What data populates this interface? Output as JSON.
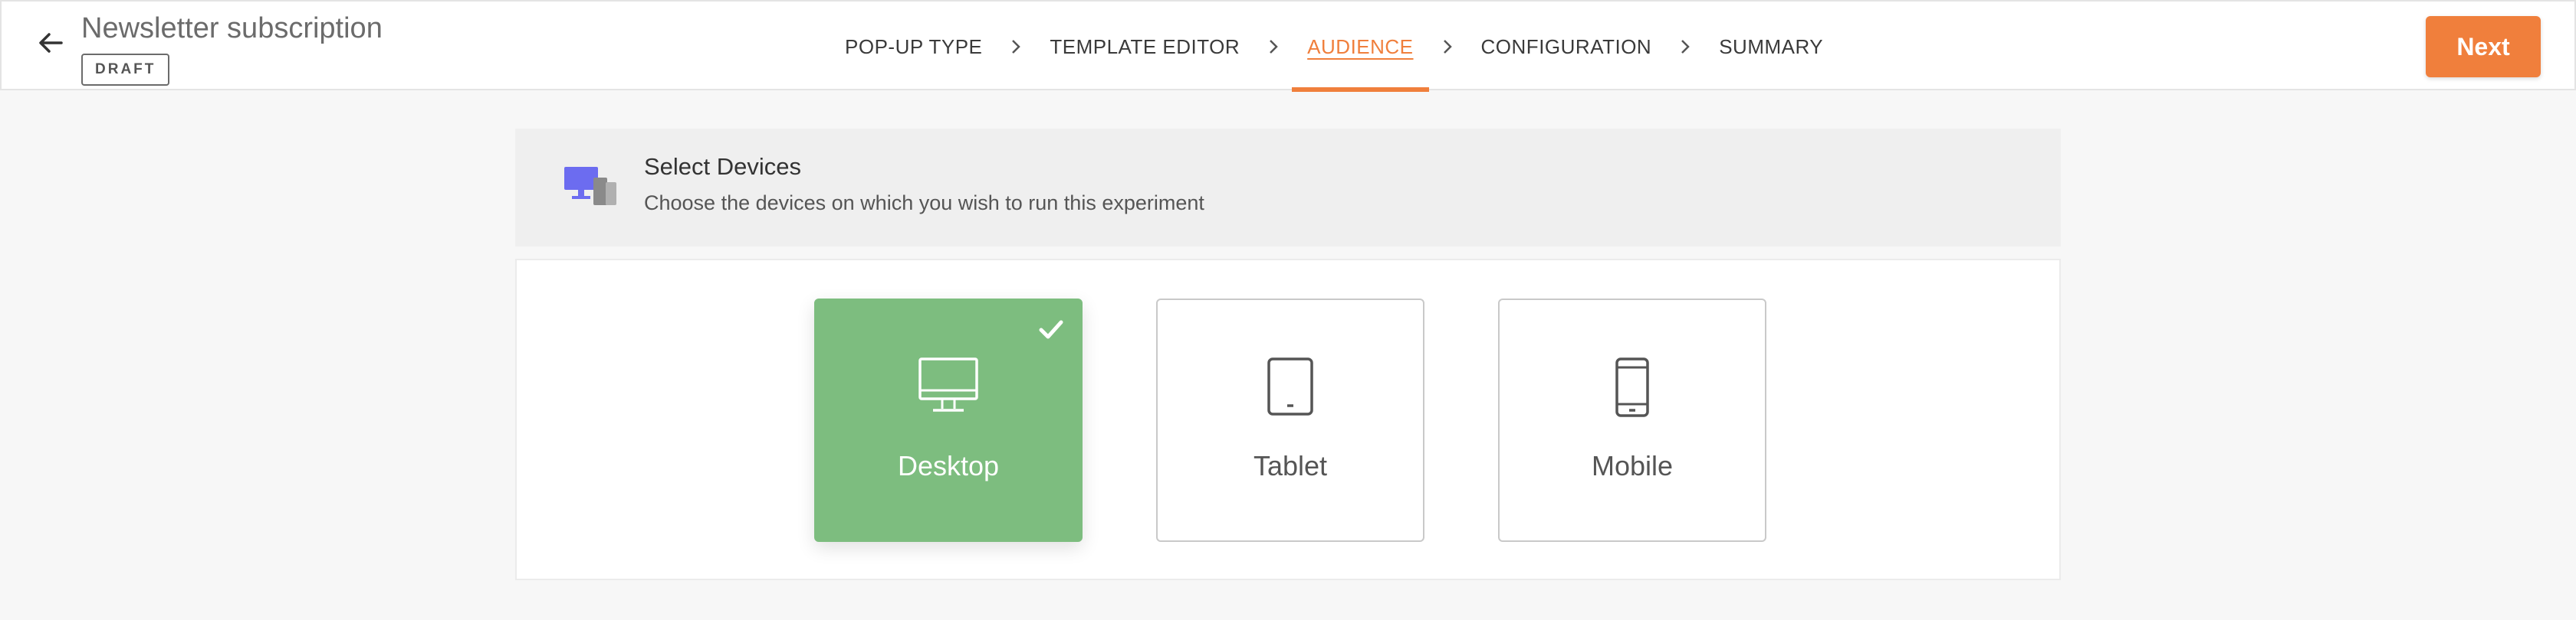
{
  "header": {
    "title": "Newsletter subscription",
    "status_badge": "DRAFT",
    "next_label": "Next"
  },
  "stepper": {
    "steps": [
      {
        "label": "POP-UP TYPE",
        "active": false
      },
      {
        "label": "TEMPLATE EDITOR",
        "active": false
      },
      {
        "label": "AUDIENCE",
        "active": true
      },
      {
        "label": "CONFIGURATION",
        "active": false
      },
      {
        "label": "SUMMARY",
        "active": false
      }
    ]
  },
  "section": {
    "title": "Select Devices",
    "subtitle": "Choose the devices on which you wish to run this experiment",
    "icon": "devices-icon"
  },
  "devices": [
    {
      "label": "Desktop",
      "icon": "desktop-icon",
      "selected": true
    },
    {
      "label": "Tablet",
      "icon": "tablet-icon",
      "selected": false
    },
    {
      "label": "Mobile",
      "icon": "mobile-icon",
      "selected": false
    }
  ],
  "colors": {
    "accent": "#f07f3c",
    "selected": "#7dbd7f",
    "banner_icon": "#6c6cf0"
  }
}
